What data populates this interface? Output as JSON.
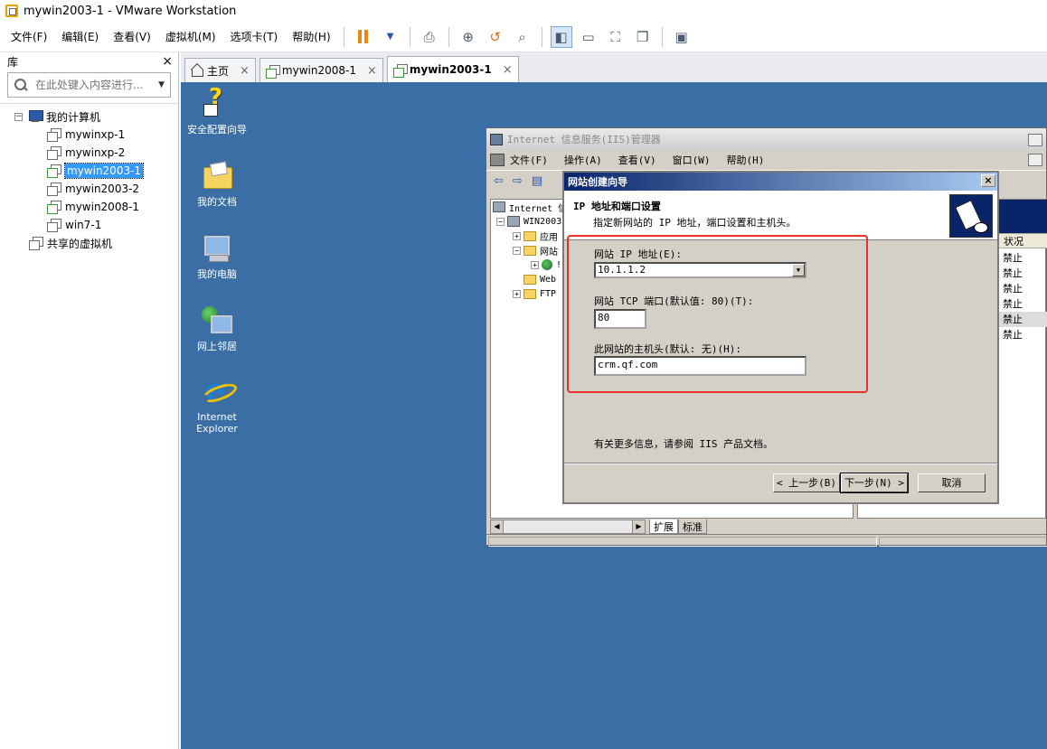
{
  "window": {
    "title": "mywin2003-1 - VMware Workstation"
  },
  "menu": {
    "items": [
      "文件(F)",
      "编辑(E)",
      "查看(V)",
      "虚拟机(M)",
      "选项卡(T)",
      "帮助(H)"
    ]
  },
  "library": {
    "header": "库",
    "close": "×",
    "search_placeholder": "在此处键入内容进行...",
    "tree": {
      "root": "我的计算机",
      "vms": [
        "mywinxp-1",
        "mywinxp-2",
        "mywin2003-1",
        "mywin2003-2",
        "mywin2008-1",
        "win7-1"
      ],
      "selected": "mywin2003-1",
      "shared": "共享的虚拟机"
    }
  },
  "tabs": [
    {
      "label": "主页",
      "close": "×"
    },
    {
      "label": "mywin2008-1",
      "close": "×"
    },
    {
      "label": "mywin2003-1",
      "close": "×"
    }
  ],
  "desktop": {
    "icons": [
      "安全配置向导",
      "我的文档",
      "我的电脑",
      "网上邻居",
      "Internet Explorer"
    ]
  },
  "iis": {
    "title": "Internet 信息服务(IIS)管理器",
    "menu": [
      "文件(F)",
      "操作(A)",
      "查看(V)",
      "窗口(W)",
      "帮助(H)"
    ],
    "tree": [
      {
        "label": "Internet 信",
        "level": 0
      },
      {
        "label": "WIN2003",
        "level": 1
      },
      {
        "label": "应用",
        "level": 2
      },
      {
        "label": "网站",
        "level": 2
      },
      {
        "label": "!",
        "level": 3
      },
      {
        "label": "Web",
        "level": 2
      },
      {
        "label": "FTP",
        "level": 2
      }
    ],
    "column_header": "状况",
    "status_rows": [
      "禁止",
      "禁止",
      "禁止",
      "禁止",
      "禁止",
      "禁止"
    ],
    "bottom_tabs": [
      "扩展",
      "标准"
    ]
  },
  "wizard": {
    "title": "网站创建向导",
    "close": "×",
    "heading": "IP 地址和端口设置",
    "subheading": "指定新网站的 IP 地址，端口设置和主机头。",
    "ip_label": "网站 IP 地址(E):",
    "ip_value": "10.1.1.2",
    "port_label": "网站 TCP 端口(默认值: 80)(T):",
    "port_value": "80",
    "host_label": "此网站的主机头(默认: 无)(H):",
    "host_value": "crm.qf.com",
    "info": "有关更多信息，请参阅 IIS 产品文档。",
    "back_button": "< 上一步(B)",
    "next_button": "下一步(N) >",
    "cancel_button": "取消"
  },
  "colors": {
    "desktop": "#3a6ea5",
    "selection": "#3399ff",
    "highlight": "#e8312a",
    "wizard_title": "#0a246a"
  }
}
